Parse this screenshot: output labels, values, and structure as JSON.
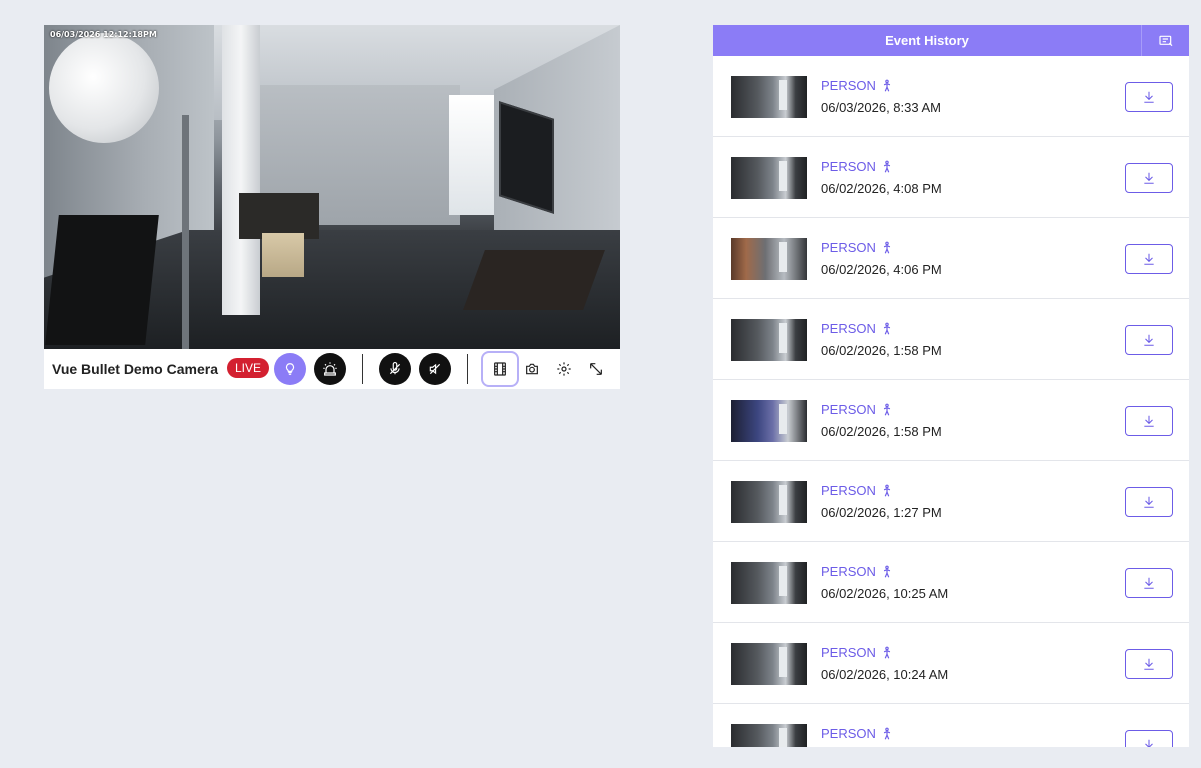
{
  "camera": {
    "timestamp": "06/03/2026 12:12:18PM",
    "name": "Vue Bullet Demo Camera",
    "live_label": "LIVE"
  },
  "toolbar": {
    "buttons": [
      {
        "name": "light-button",
        "icon": "lightbulb-icon"
      },
      {
        "name": "siren-button",
        "icon": "siren-icon"
      },
      {
        "name": "mic-mute-button",
        "icon": "mic-off-icon"
      },
      {
        "name": "speaker-mute-button",
        "icon": "speaker-off-icon"
      },
      {
        "name": "recordings-button",
        "icon": "film-icon"
      },
      {
        "name": "snapshot-button",
        "icon": "camera-icon"
      },
      {
        "name": "settings-button",
        "icon": "gear-icon"
      },
      {
        "name": "expand-button",
        "icon": "expand-icon"
      }
    ]
  },
  "events": {
    "title": "Event History",
    "header_icon": "filter-list-icon",
    "items": [
      {
        "type": "PERSON",
        "time": "06/03/2026, 8:33 AM"
      },
      {
        "type": "PERSON",
        "time": "06/02/2026, 4:08 PM"
      },
      {
        "type": "PERSON",
        "time": "06/02/2026, 4:06 PM"
      },
      {
        "type": "PERSON",
        "time": "06/02/2026, 1:58 PM"
      },
      {
        "type": "PERSON",
        "time": "06/02/2026, 1:58 PM"
      },
      {
        "type": "PERSON",
        "time": "06/02/2026, 1:27 PM"
      },
      {
        "type": "PERSON",
        "time": "06/02/2026, 10:25 AM"
      },
      {
        "type": "PERSON",
        "time": "06/02/2026, 10:24 AM"
      },
      {
        "type": "PERSON",
        "time": ""
      }
    ]
  },
  "colors": {
    "accent": "#8b7cf6",
    "link": "#6c5ce7",
    "live": "#d32030",
    "background": "#e9ecf2"
  }
}
